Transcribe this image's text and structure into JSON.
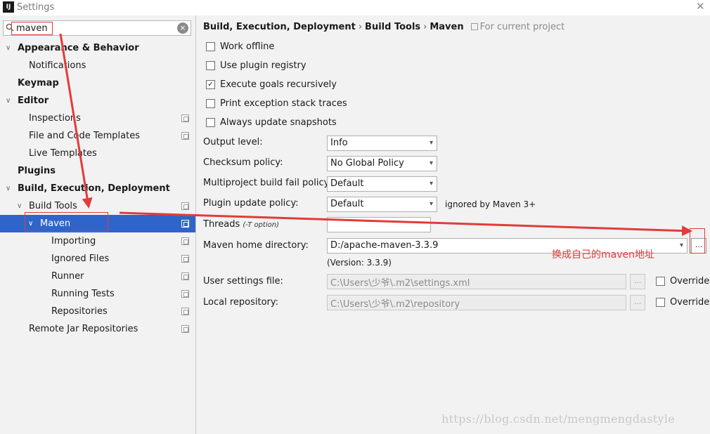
{
  "window": {
    "title": "Settings",
    "app_icon": "IJ",
    "close_glyph": "✕"
  },
  "search": {
    "value": "maven",
    "clear_glyph": "×"
  },
  "tree": [
    {
      "label": "Appearance & Behavior",
      "bold": true,
      "arrow": "∨"
    },
    {
      "label": "Notifications"
    },
    {
      "label": "Keymap",
      "bold": true
    },
    {
      "label": "Editor",
      "bold": true,
      "arrow": "∨"
    },
    {
      "label": "Inspections"
    },
    {
      "label": "File and Code Templates"
    },
    {
      "label": "Live Templates"
    },
    {
      "label": "Plugins",
      "bold": true
    },
    {
      "label": "Build, Execution, Deployment",
      "bold": true,
      "arrow": "∨"
    },
    {
      "label": "Build Tools",
      "arrow": "∨"
    },
    {
      "label": "Maven",
      "arrow": "∨",
      "selected": true
    },
    {
      "label": "Importing"
    },
    {
      "label": "Ignored Files"
    },
    {
      "label": "Runner"
    },
    {
      "label": "Running Tests"
    },
    {
      "label": "Repositories"
    },
    {
      "label": "Remote Jar Repositories"
    }
  ],
  "breadcrumb": {
    "parts": [
      "Build, Execution, Deployment",
      "Build Tools",
      "Maven"
    ],
    "separator": "›",
    "for_project": "For current project"
  },
  "checkboxes": [
    {
      "label": "Work offline",
      "checked": false
    },
    {
      "label": "Use plugin registry",
      "checked": false
    },
    {
      "label": "Execute goals recursively",
      "checked": true
    },
    {
      "label": "Print exception stack traces",
      "checked": false
    },
    {
      "label": "Always update snapshots",
      "checked": false
    }
  ],
  "check_glyph": "✓",
  "fields": {
    "output_level": {
      "label": "Output level:",
      "value": "Info"
    },
    "checksum_policy": {
      "label": "Checksum policy:",
      "value": "No Global Policy"
    },
    "multiproject_fail_policy": {
      "label": "Multiproject build fail policy:",
      "value": "Default"
    },
    "plugin_update_policy": {
      "label": "Plugin update policy:",
      "value": "Default",
      "hint": "ignored by Maven 3+"
    },
    "threads": {
      "label": "Threads",
      "sub_label": "(-T option)",
      "value": ""
    },
    "maven_home": {
      "label": "Maven home directory:",
      "value": "D:/apache-maven-3.3.9",
      "version": "(Version: 3.3.9)"
    },
    "user_settings": {
      "label": "User settings file:",
      "value": "C:\\Users\\少爷\\.m2\\settings.xml",
      "override": "Override"
    },
    "local_repository": {
      "label": "Local repository:",
      "value": "C:\\Users\\少爷\\.m2\\repository",
      "override": "Override"
    }
  },
  "dropdown_glyph": "▾",
  "browse_label": "...",
  "annotation": {
    "text": "换成自己的maven地址",
    "color": "#e23b3b"
  },
  "watermark": "https://blog.csdn.net/mengmengdastyle",
  "colors": {
    "selection": "#2f65ca",
    "annotation": "#e23b3b"
  }
}
